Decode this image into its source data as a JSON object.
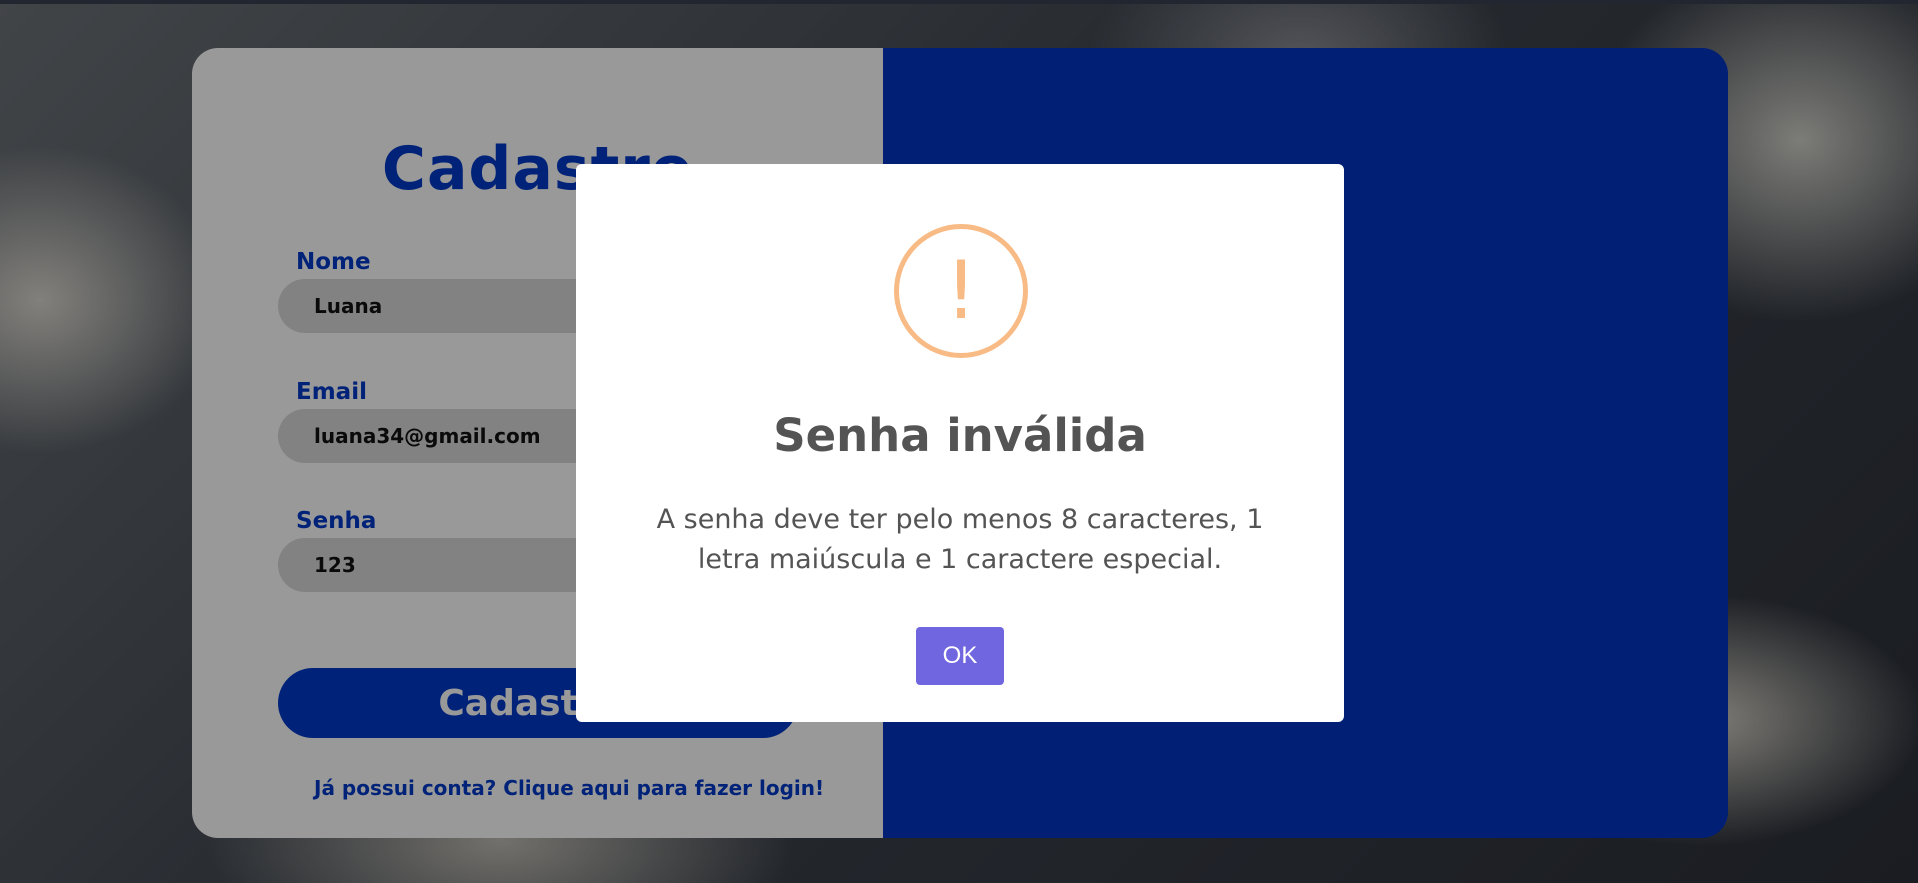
{
  "form": {
    "title": "Cadastro",
    "name_label": "Nome",
    "name_value": "Luana",
    "email_label": "Email",
    "email_value": "luana34@gmail.com",
    "password_label": "Senha",
    "password_value": "123",
    "submit_label": "Cadastrar",
    "login_link": "Já possui conta? Clique aqui para fazer login!"
  },
  "modal": {
    "icon": "warning-icon",
    "icon_glyph": "!",
    "title": "Senha inválida",
    "message": "A senha deve ter pelo menos 8 caracteres, 1 letra maiúscula e 1 caractere especial.",
    "ok_label": "OK"
  },
  "colors": {
    "brand_blue": "#0039c8",
    "warning": "#f8bb86",
    "ok_button": "#7066e0"
  }
}
